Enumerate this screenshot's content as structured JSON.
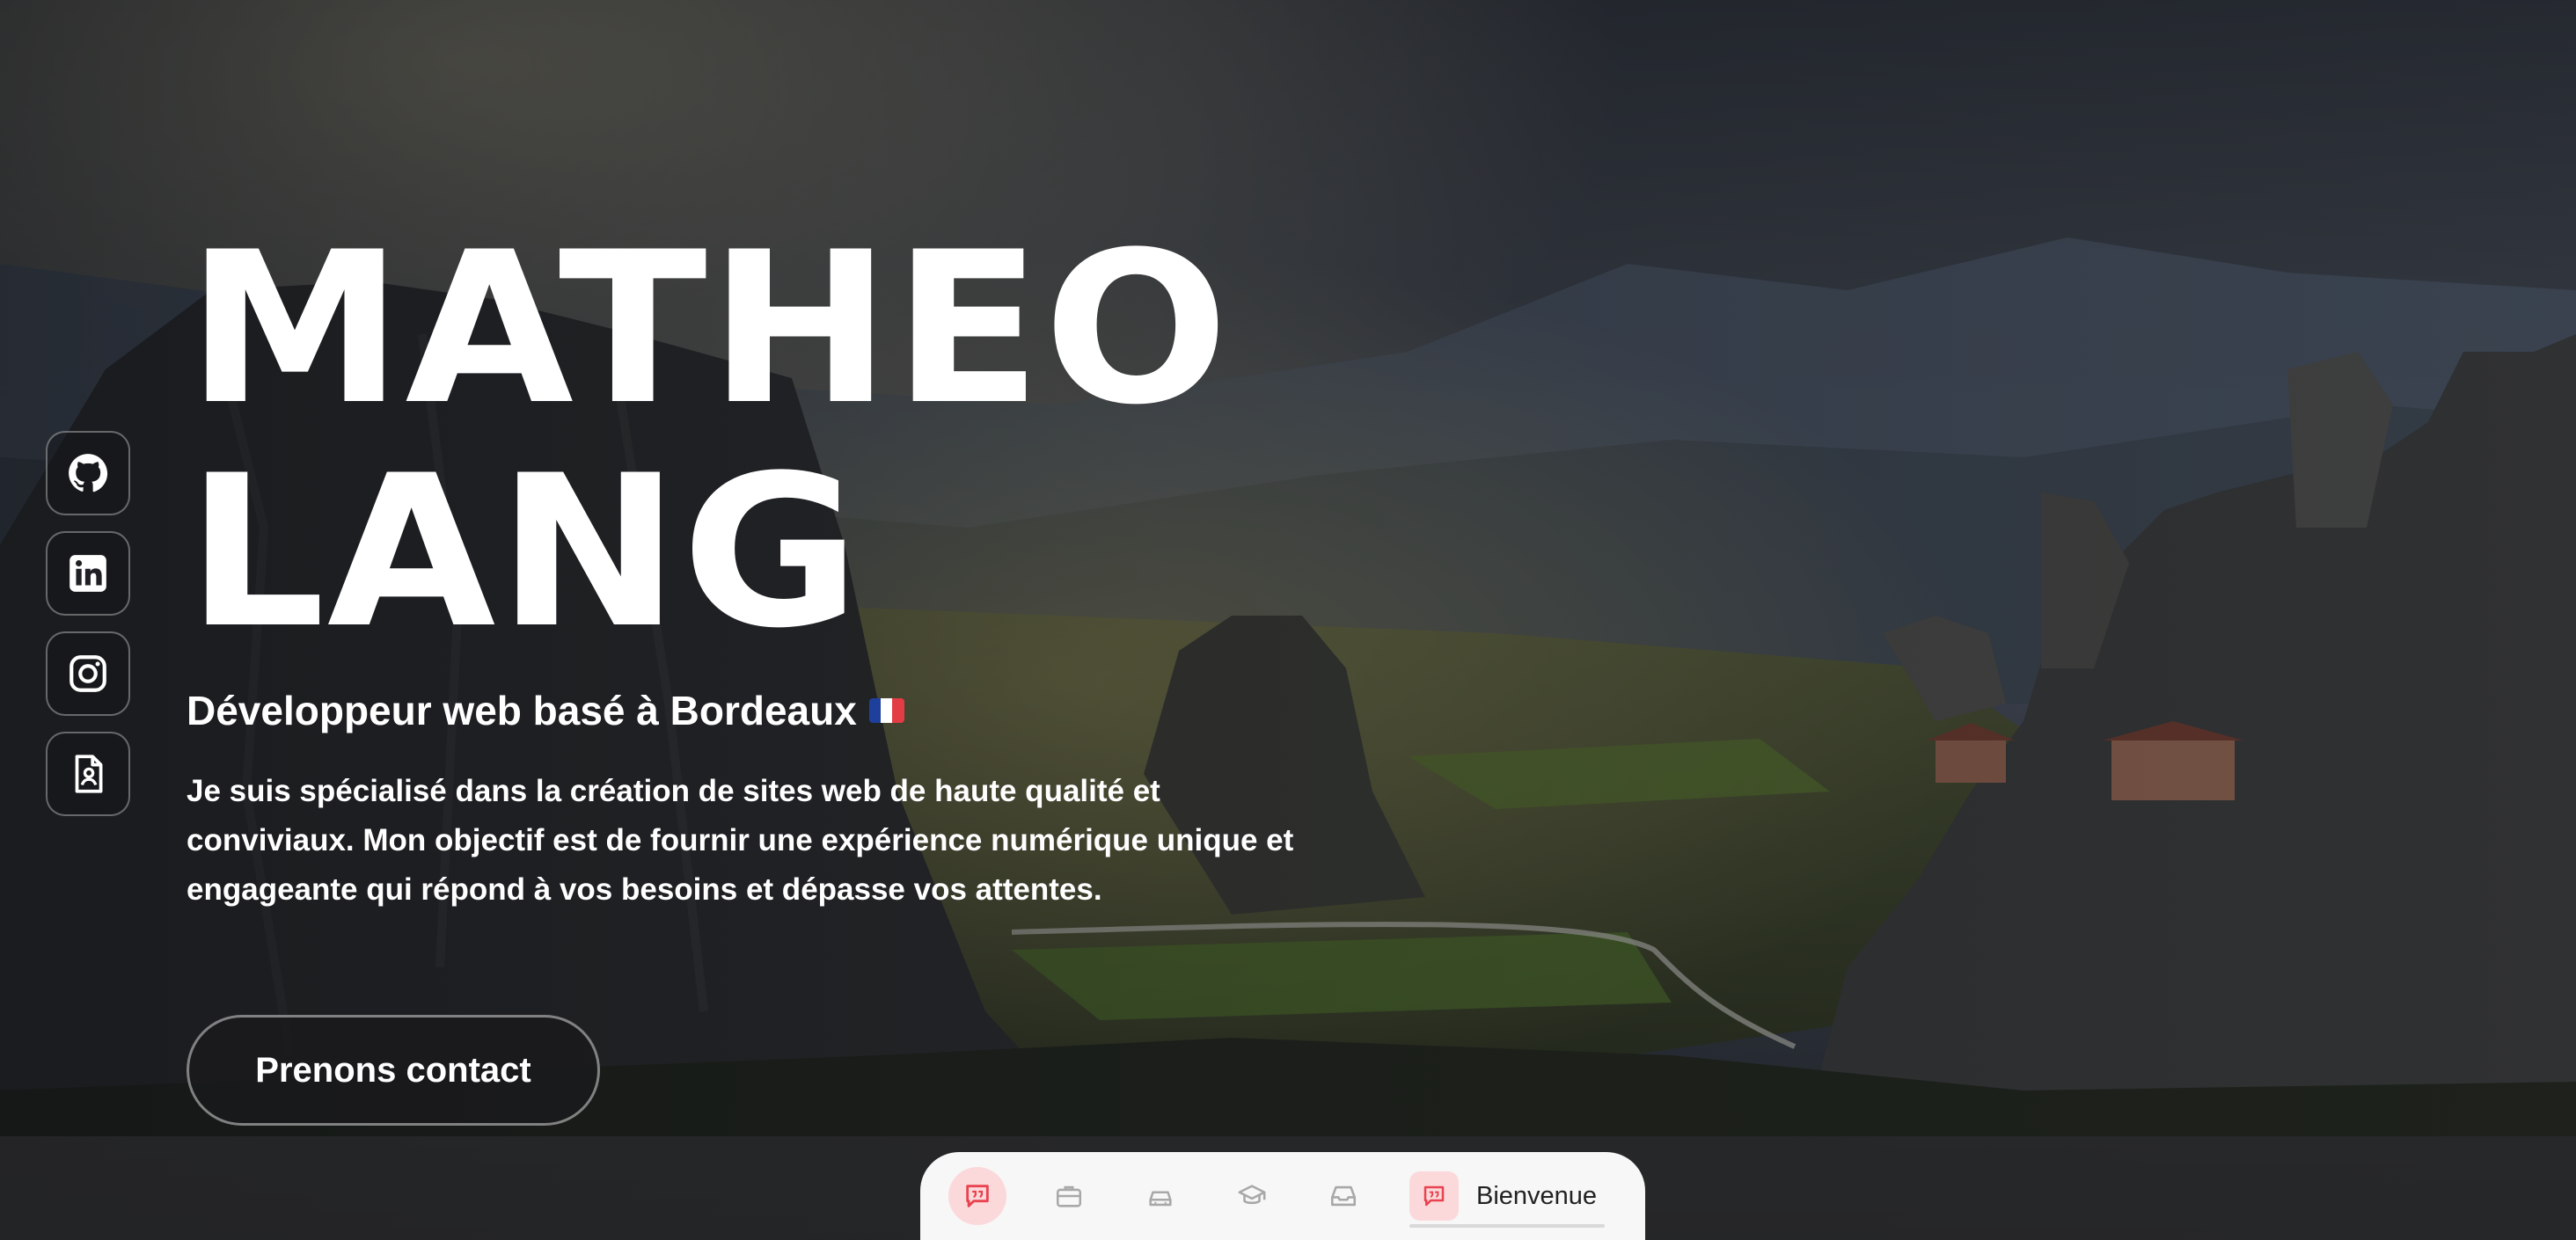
{
  "colors": {
    "accent": "#e8434f",
    "accent_soft": "#fbd9db",
    "text_light": "#ffffff",
    "nav_bg": "#f7f7f7"
  },
  "social": [
    {
      "name": "github",
      "icon": "github-icon"
    },
    {
      "name": "linkedin",
      "icon": "linkedin-icon"
    },
    {
      "name": "instagram",
      "icon": "instagram-icon"
    },
    {
      "name": "resume",
      "icon": "resume-icon"
    }
  ],
  "hero": {
    "first_name": "MATHEO",
    "last_name": "LANG",
    "subtitle": "Développeur web basé à Bordeaux",
    "flag": "flag-france-icon",
    "bio": "Je suis spécialisé dans la création de sites web de haute qualité et conviviaux. Mon objectif est de fournir une expérience numérique unique et engageante qui répond à vos besoins et dépasse vos attentes.",
    "cta": "Prenons contact"
  },
  "nav": {
    "items": [
      {
        "icon": "chat-icon",
        "active": true
      },
      {
        "icon": "briefcase-icon",
        "active": false
      },
      {
        "icon": "car-icon",
        "active": false
      },
      {
        "icon": "graduation-cap-icon",
        "active": false
      },
      {
        "icon": "inbox-icon",
        "active": false
      }
    ],
    "current_label": "Bienvenue"
  }
}
